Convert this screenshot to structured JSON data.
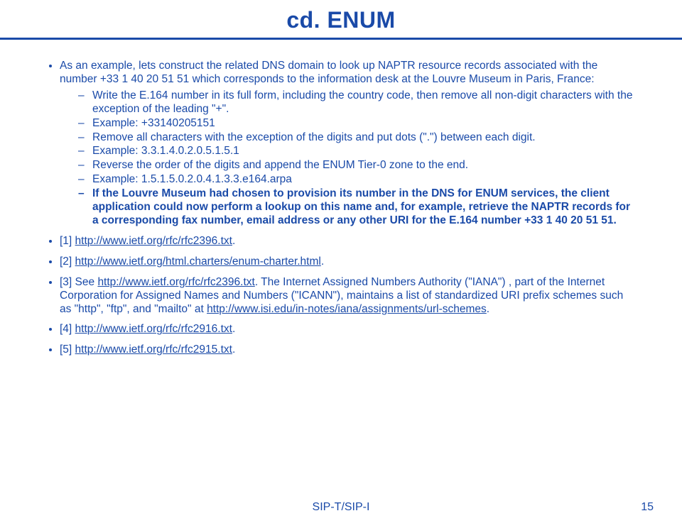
{
  "title": "cd. ENUM",
  "intro": "As an example, lets construct the related DNS domain to look up NAPTR resource records associated with the number +33 1 40 20 51 51 which corresponds to the information desk at the Louvre Museum in Paris, France:",
  "steps": {
    "s1": "Write the E.164 number in its full form, including the country code, then remove all non-digit characters with the exception of the leading \"+\".",
    "s2": "Example: +33140205151",
    "s3": "Remove all characters with the exception of the digits and put dots (\".\") between each digit.",
    "s4": "Example: 3.3.1.4.0.2.0.5.1.5.1",
    "s5": "Reverse the order of the digits and append the ENUM Tier-0 zone to the end.",
    "s6": "Example: 1.5.1.5.0.2.0.4.1.3.3.e164.arpa",
    "s7": "If the Louvre Museum had chosen to provision its number in the DNS for ENUM services, the client application could now perform a lookup on this name and, for example, retrieve the NAPTR records for a corresponding fax number, email address or any other URI for the E.164 number +33 1 40 20 51 51."
  },
  "refs": {
    "r1_label": "[1] ",
    "r1_link": "http://www.ietf.org/rfc/rfc2396.txt",
    "r2_label": "[2] ",
    "r2_link": "http://www.ietf.org/html.charters/enum-charter.html",
    "r3_label": "[3] See ",
    "r3_link": "http://www.ietf.org/rfc/rfc2396.txt",
    "r3_tail": ".  The Internet Assigned Numbers Authority (\"IANA\") , part of the Internet Corporation for Assigned Names and Numbers (\"ICANN\"), maintains a list of standardized URI prefix schemes such as \"http\", \"ftp\", and \"mailto\" at ",
    "r3_link2": "http://www.isi.edu/in-notes/iana/assignments/url-schemes",
    "r4_label": "[4] ",
    "r4_link": "http://www.ietf.org/rfc/rfc2916.txt",
    "r5_label": "[5] ",
    "r5_link": "http://www.ietf.org/rfc/rfc2915.txt",
    "dot": "."
  },
  "footer": "SIP-T/SIP-I",
  "pagenum": "15"
}
